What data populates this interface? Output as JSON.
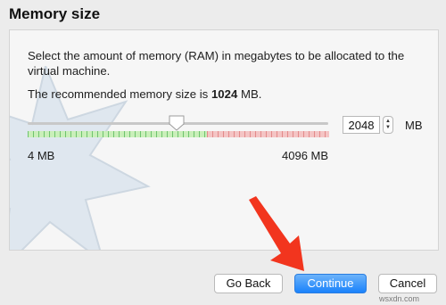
{
  "dialog": {
    "title": "Memory size",
    "description": "Select the amount of memory (RAM) in megabytes to be allocated to the virtual machine.",
    "recommended_prefix": "The recommended memory size is ",
    "recommended_value": "1024",
    "recommended_suffix": " MB."
  },
  "memory": {
    "slider_min_label": "4 MB",
    "slider_max_label": "4096 MB",
    "slider_min_mb": 4,
    "slider_max_mb": 4096,
    "current_value_mb": 2048,
    "input_value": "2048",
    "unit": "MB"
  },
  "buttons": {
    "back": "Go Back",
    "continue": "Continue",
    "cancel": "Cancel"
  },
  "watermark": "wsxdn.com",
  "colors": {
    "accent": "#1a82fb",
    "arrow": "#f2351e",
    "safe_range": "#c9efb9",
    "warning_range": "#f4c4c4"
  }
}
